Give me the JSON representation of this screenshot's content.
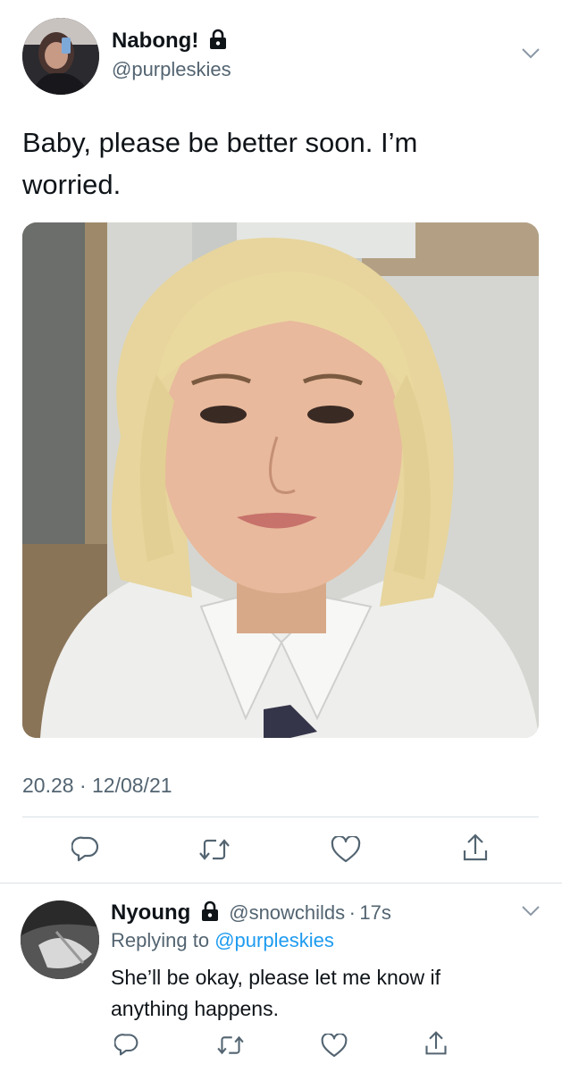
{
  "tweet": {
    "author_name": "Nabong!",
    "author_handle": "@purpleskies",
    "text": "Baby, please be better soon. I’m worried.",
    "timestamp": "20.28 · 12/08/21"
  },
  "reply": {
    "author_name": "Nyoung",
    "author_handle": "@snowchilds",
    "separator": "·",
    "time_ago": "17s",
    "replying_to_label": "Replying to",
    "replying_to_handle": "@purpleskies",
    "text": "She’ll be okay, please let me know if anything happens."
  },
  "icons": {
    "reply": "reply-icon",
    "retweet": "retweet-icon",
    "like": "heart-icon",
    "share": "share-icon",
    "lock": "lock-icon",
    "more": "chevron-down-icon"
  },
  "colors": {
    "link": "#1d9bf0",
    "secondary_text": "#536471",
    "divider": "#dbe1e6"
  }
}
